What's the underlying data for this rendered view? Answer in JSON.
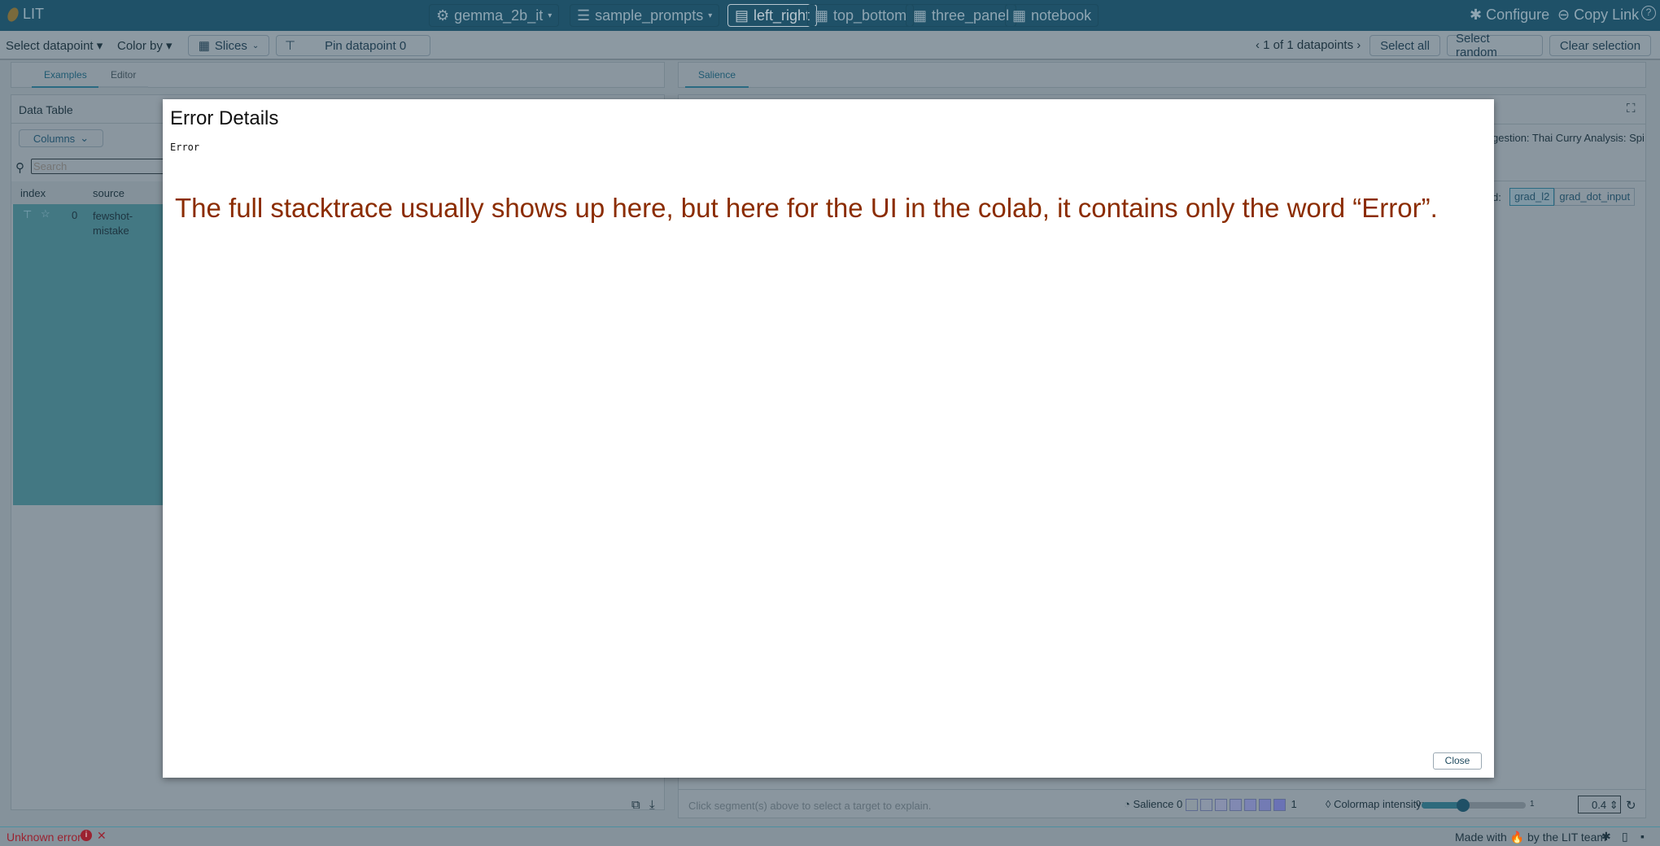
{
  "header": {
    "app_title": "LIT",
    "model": "gemma_2b_it",
    "dataset": "sample_prompts",
    "layouts": [
      "left_right",
      "top_bottom",
      "three_panel",
      "notebook"
    ],
    "selected_layout": "left_right",
    "configure": "Configure",
    "copy_link": "Copy Link"
  },
  "toolbar": {
    "select_datapoint": "Select datapoint",
    "color_by": "Color by",
    "slices": "Slices",
    "pin": "Pin datapoint 0",
    "count": "1 of 1 datapoints",
    "select_all": "Select all",
    "select_random": "Select random",
    "clear_selection": "Clear selection"
  },
  "left": {
    "tabs": [
      "Examples",
      "Editor"
    ],
    "active_tab": "Examples",
    "panel_title": "Data Table",
    "columns_button": "Columns",
    "search_placeholder": "Search",
    "headers": [
      "index",
      "source"
    ],
    "rows": [
      {
        "index": "0",
        "source": "fewshot-mistake"
      }
    ]
  },
  "right": {
    "tabs": [
      "Salience"
    ],
    "active_tab": "Salience",
    "text_snippet": "gestion: Thai Curry Analysis: Spi",
    "method_label": "d:",
    "methods": [
      "grad_l2",
      "grad_dot_input"
    ],
    "selected_method": "grad_l2",
    "hint": "Click segment(s) above to select a target to explain.",
    "salience_label": "Salience",
    "scale_min": "0",
    "scale_max": "1",
    "colormap_label": "Colormap intensity:",
    "slider_min": "0",
    "slider_max": "1",
    "intensity": "0.4",
    "intensity_value": 0.4
  },
  "modal": {
    "title": "Error Details",
    "body": "Error",
    "annotation": "The full stacktrace usually shows up here, but here for the UI in the colab, it contains only the word “Error”.",
    "close": "Close",
    "annotation_color": "#8b2c00"
  },
  "status": {
    "error": "Unknown error",
    "footer": "Made with 🔥 by the LIT team"
  }
}
